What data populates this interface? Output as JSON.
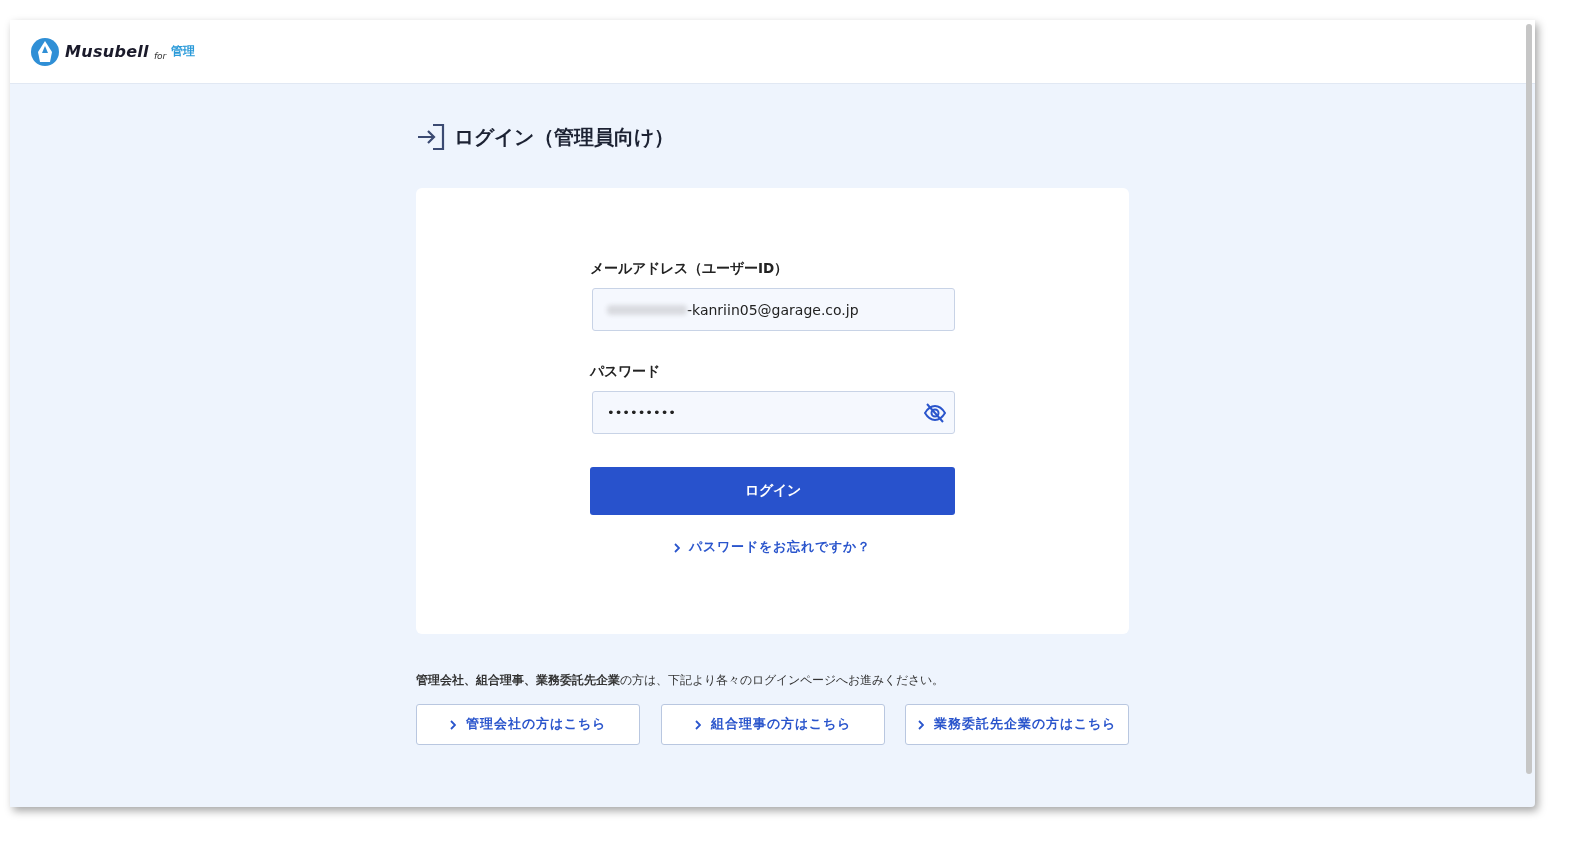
{
  "header": {
    "brand": "Musubell",
    "brand_suffix_small": "for",
    "brand_suffix": "管理"
  },
  "page_title": "ログイン（管理員向け）",
  "form": {
    "email_label": "メールアドレス（ユーザーID）",
    "email_value": "-kanriin05@garage.co.jp",
    "password_label": "パスワード",
    "password_value": "•••••••••",
    "submit": "ログイン",
    "forgot_link": "パスワードをお忘れですか？"
  },
  "notice": "**管理会社、組合理事、業務委託先企業**の方は、下記より各々のログインページへお進みください。",
  "other_logins": [
    "管理会社の方はこちら",
    "組合理事の方はこちら",
    "業務委託先企業の方はこちら"
  ]
}
